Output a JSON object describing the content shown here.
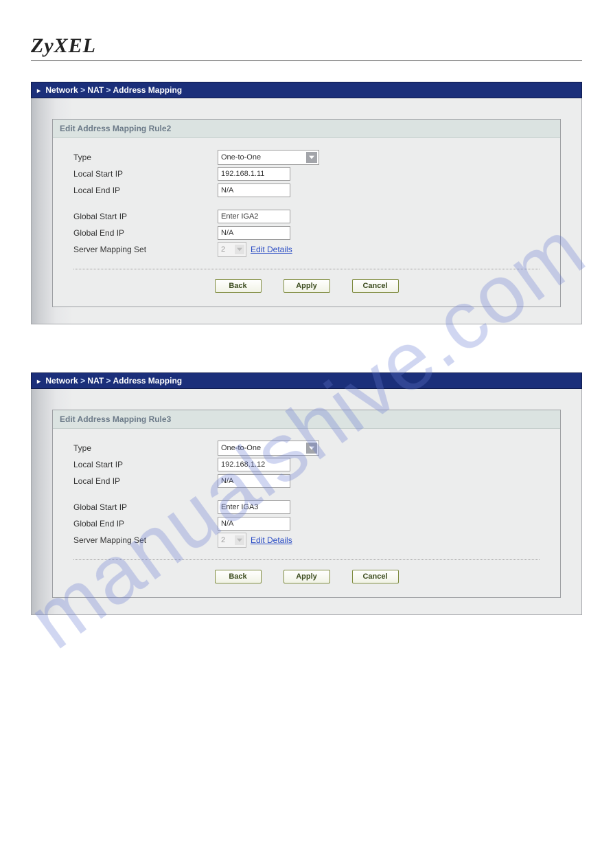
{
  "logo": "ZyXEL",
  "watermark": "manualshive.com",
  "breadcrumb": {
    "arrow": "▸",
    "part1": "Network",
    "sep": ">",
    "part2": "NAT",
    "part3": "Address Mapping"
  },
  "panels": [
    {
      "title": "Edit Address Mapping Rule2",
      "type_label": "Type",
      "type_value": "One-to-One",
      "lsip_label": "Local Start IP",
      "lsip_value": "192.168.1.11",
      "leip_label": "Local End IP",
      "leip_value": "N/A",
      "gsip_label": "Global Start IP",
      "gsip_value": "Enter IGA2",
      "geip_label": "Global End IP",
      "geip_value": "N/A",
      "sms_label": "Server Mapping Set",
      "sms_value": "2",
      "edit_link": "Edit Details",
      "btn_back": "Back",
      "btn_apply": "Apply",
      "btn_cancel": "Cancel"
    },
    {
      "title": "Edit Address Mapping Rule3",
      "type_label": "Type",
      "type_value": "One-to-One",
      "lsip_label": "Local Start IP",
      "lsip_value": "192.168.1.12",
      "leip_label": "Local End IP",
      "leip_value": "N/A",
      "gsip_label": "Global Start IP",
      "gsip_value": "Enter IGA3",
      "geip_label": "Global End IP",
      "geip_value": "N/A",
      "sms_label": "Server Mapping Set",
      "sms_value": "2",
      "edit_link": "Edit Details",
      "btn_back": "Back",
      "btn_apply": "Apply",
      "btn_cancel": "Cancel"
    }
  ]
}
